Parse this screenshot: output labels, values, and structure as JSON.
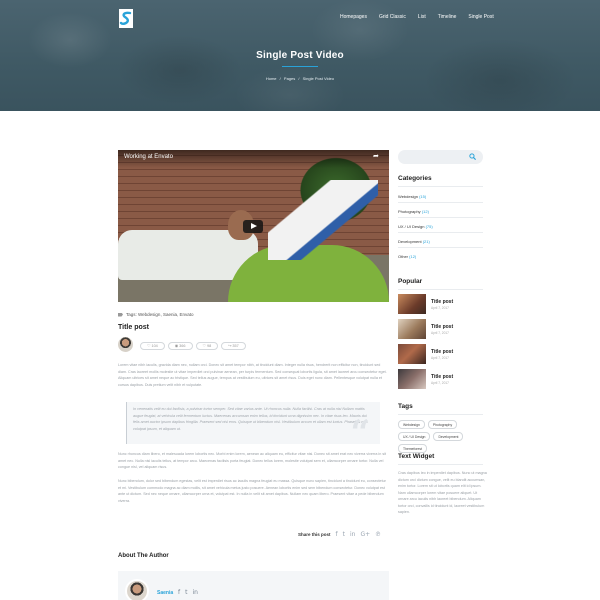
{
  "header": {
    "nav": [
      "Homepages",
      "Grid Classic",
      "List",
      "Timeline",
      "Single Post"
    ],
    "title": "Single Post Video",
    "breadcrumb": [
      "Home",
      "/",
      "Pages",
      "/",
      "Single Post Video"
    ]
  },
  "video": {
    "title": "Working at Envato"
  },
  "post": {
    "tags_label": "Tags: Webdesign, Saenia, Envato",
    "title": "Title post",
    "stats": [
      "♡ 104",
      "◉ 366",
      "♡ 98",
      "↪ 357"
    ],
    "paragraph1": "Lorem vitae nibh iaculis, gravida diam nec, nullam orci. Donec sit amet tempor nibh, at tincidunt diam. Integer nulla risus, hendrerit non efficitur non, tincidunt sed diam. Cras laoreet mollis molestie ut vitae imperdiet orci pulvinar aenean, per turpis fermentum. Sed consequat lobortis ligula, sit amet laoreet arcu consectetur eget. Aliquam ultrices sit amet neque ac tristique. Sed tellus augue, tempus at vestibulum eu, ultrices sit amet risus. Duis eget nunc diam. Pellentesque volutpat nulla et cursus dapibus. Duis pretium velit nibh et vulputate.",
    "quote": "In venenatis velit eu dui facilisis, a pulvinar tortor semper. Sed vitae varius ante. Ut rhoncus nulla. Nulla facilisi. Cras at nulla nisi Nullam mattis augue feugiat, at vehicula velit fermentum luctus. Maecenas accumsan enim tellus, id tincidunt urna dignissim nec. In vitae risus leo. Mauris dui felis amet auctor ipsum dapibus fringilla. Praesent sed nisl eros. Quisque ut bibendum nisl. Vestibulum accum et ullam est luctus. Phasellus non volutpat ipsum, et aliquam ut.",
    "paragraph2": "Nunc rhoncus diam libero, et malesuada lorem lobortis nec. Morbi enim lorem, aenean ac aliquam eu, efficitur vitae nisi. Donec sit amet erat nec viverra viverra in sit amet nec. Nulla nisl iaculis tellus, at tempor arcu. Maecenas facilisis porta feugiat. Donec tellus lorem, molestie volutpat sem et, ullamcorper ornare tortor. Nulla vel congue nisl, vel aliquam risus.",
    "paragraph3": "Nunc bibendum, dolor sed bibendum egestas, velit est imperdiet risus ac iaculis magna feugiat eu massa. Quisque nunc sapien, tincidunt a tincidunt eu, consectetur et mi. Vestibulum commodo magna ac diam mollis, sit amet vehicula metus justo posuere. Aenean lobortis enim sed sem bibendum consectetur. Donec volutpat est ante ut dictum. Sed nec neque ornare, ullamcorper urna et, volutpat est. In nulla in velit sit amet dapibus. Nullam nec quam libero. Praesent vitae a pede bibendum viverra.",
    "share_label": "Share this post",
    "share_icons": [
      "f",
      "t",
      "in",
      "G+",
      "℗"
    ]
  },
  "author": {
    "section_title": "About The Author",
    "name": "Saenia",
    "social": [
      "f",
      "t",
      "in"
    ]
  },
  "sidebar": {
    "search_placeholder": "",
    "categories_title": "Categories",
    "categories": [
      {
        "name": "Webdesign",
        "count": "(15)"
      },
      {
        "name": "Photography",
        "count": "(12)"
      },
      {
        "name": "UX / UI Design",
        "count": "(75)"
      },
      {
        "name": "Development",
        "count": "(21)"
      },
      {
        "name": "Other",
        "count": "(12)"
      }
    ],
    "popular_title": "Popular",
    "popular": [
      {
        "title": "Title post",
        "date": "April 7, 2017"
      },
      {
        "title": "Title post",
        "date": "April 7, 2017"
      },
      {
        "title": "Title post",
        "date": "April 7, 2017"
      },
      {
        "title": "Title post",
        "date": "April 7, 2017"
      }
    ],
    "tags_title": "Tags",
    "tags": [
      "Webdesign",
      "Photography",
      "UX / UI Design",
      "Development",
      "Themeforest"
    ],
    "text_widget_title": "Text Widget",
    "text_widget_body": "Cras dapibus leo in imperdiet dapibus. Nunc ut magna dictum orci dictum congue, velit eu blandit accumsan, enim tortor. Lorem sit ut lobortis quam elit id ipsum. Nam ullamcorper lorem vitae posuere aliquet. Ut ornare arcu iaculis nibh laoreet bibendum. Aliquam tortor orci, convallis id tincidunt id, laoreet vestibulum sapien."
  }
}
